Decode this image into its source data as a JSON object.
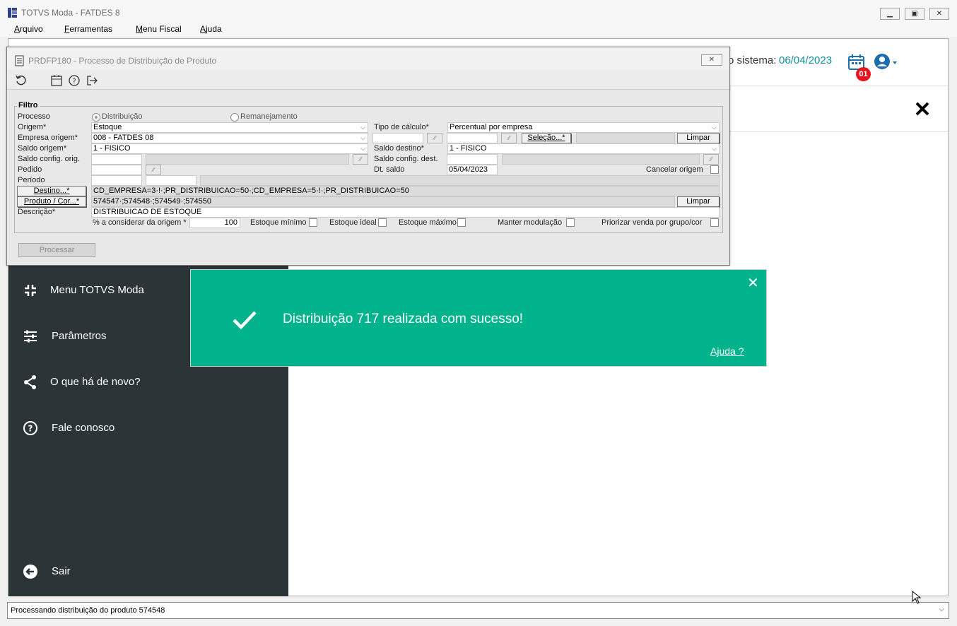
{
  "window": {
    "title": "TOTVS Moda - FATDES 8"
  },
  "menu": [
    "Arquivo",
    "Ferramentas",
    "Menu Fiscal",
    "Ajuda"
  ],
  "header": {
    "date_label": "o sistema:",
    "date": "06/04/2023",
    "badge": "01"
  },
  "dialog": {
    "title": "PRDFP180 - Processo de Distribuição de Produto",
    "close": "✕",
    "filtro": "Filtro",
    "processo_label": "Processo",
    "processo_opt1": "Distribuição",
    "processo_opt2": "Remanejamento",
    "origem_label": "Origem*",
    "origem_value": "Estoque",
    "tipo_calculo_label": "Tipo de cálculo*",
    "tipo_calculo_value": "Percentual por empresa",
    "empresa_origem_label": "Empresa origem*",
    "empresa_origem_value": "008 - FATDES 08",
    "selecao_button": "Seleção...*",
    "limpar_button": "Limpar",
    "saldo_origem_label": "Saldo origem*",
    "saldo_origem_value": "1 - FISICO",
    "saldo_destino_label": "Saldo destino*",
    "saldo_destino_value": "1 - FISICO",
    "saldo_config_orig_label": "Saldo config. orig.",
    "saldo_config_dest_label": "Saldo config. dest.",
    "pedido_label": "Pedido",
    "dt_saldo_label": "Dt. saldo",
    "dt_saldo_value": "05/04/2023",
    "cancelar_origem_label": "Cancelar origem",
    "periodo_label": "Período",
    "destino_button": "Destino...*",
    "destino_value": "CD_EMPRESA=3·!·;PR_DISTRIBUICAO=50·;CD_EMPRESA=5·!·;PR_DISTRIBUICAO=50",
    "produto_button": "Produto / Cor...*",
    "produto_value": "574547·;574548·;574549·;574550",
    "limpar2_button": "Limpar",
    "descricao_label": "Descrição*",
    "descricao_value": "DISTRIBUICAO DE ESTOQUE",
    "pct_label": "% a considerar da origem *",
    "pct_value": "100",
    "estoque_minimo": "Estoque mínimo",
    "estoque_ideal": "Estoque ideal",
    "estoque_maximo": "Estoque máximo",
    "manter_modulacao": "Manter modulação",
    "priorizar": "Priorizar venda por grupo/cor",
    "processar_button": "Processar"
  },
  "sidebar": {
    "items": [
      "Menu TOTVS Moda",
      "Parâmetros",
      "O que há de novo?",
      "Fale conosco",
      "Sair"
    ]
  },
  "toast": {
    "message": "Distribuição 717 realizada com sucesso!",
    "help": "Ajuda ?",
    "close": "✕"
  },
  "status": {
    "text": "Processando distribuição do produto 574548"
  },
  "colors": {
    "toast": "#00b38c",
    "sidebar": "#2b3437",
    "accent": "#0d8f9a",
    "badge": "#e6141e"
  }
}
